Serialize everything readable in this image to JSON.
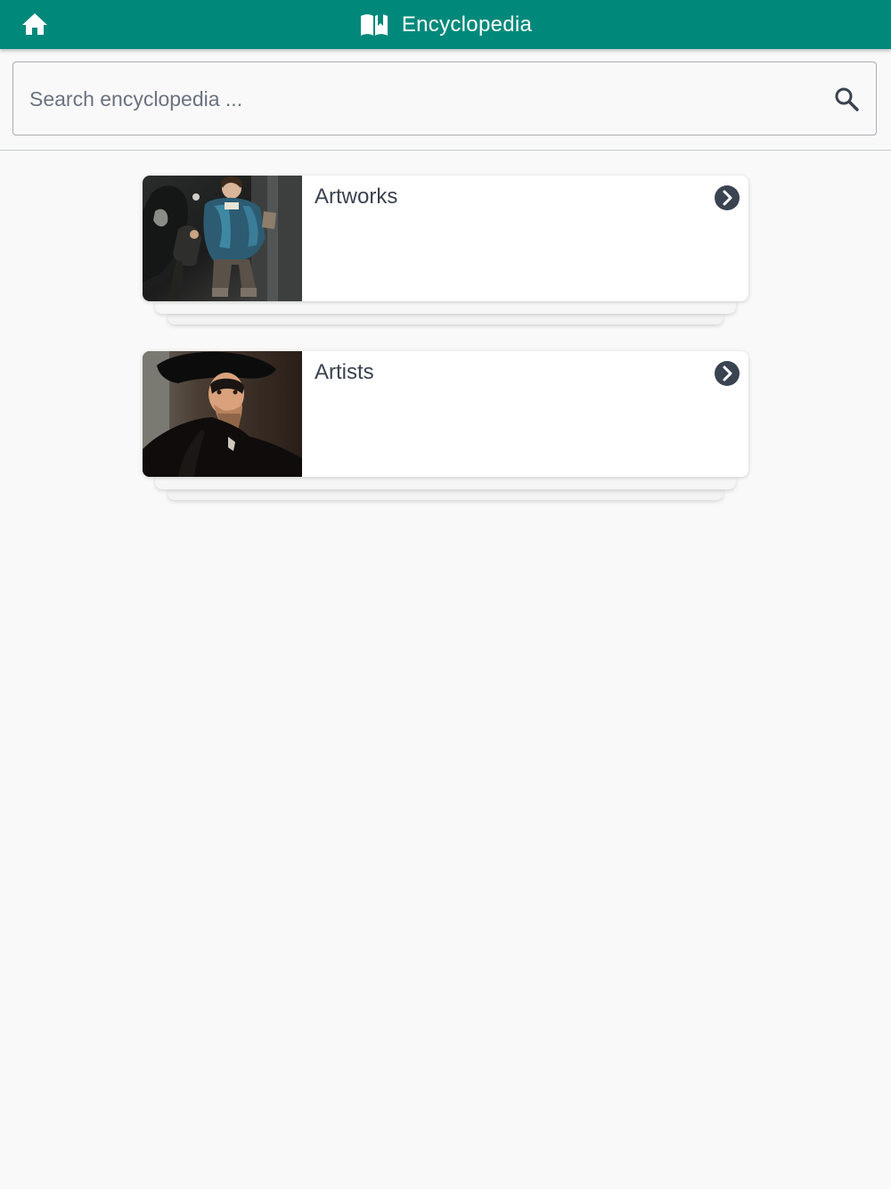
{
  "header": {
    "title": "Encyclopedia",
    "home_icon": "home-icon",
    "title_icon": "open-book-icon",
    "color": "#00897b"
  },
  "search": {
    "placeholder": "Search encyclopedia ...",
    "value": "",
    "icon": "search-icon"
  },
  "categories": [
    {
      "label": "Artworks",
      "thumbnail": "baroque portrait of a child in a blue doublet",
      "icon": "chevron-right-circle-icon"
    },
    {
      "label": "Artists",
      "thumbnail": "self-portrait of a bearded man in a wide black hat",
      "icon": "chevron-right-circle-icon"
    }
  ]
}
